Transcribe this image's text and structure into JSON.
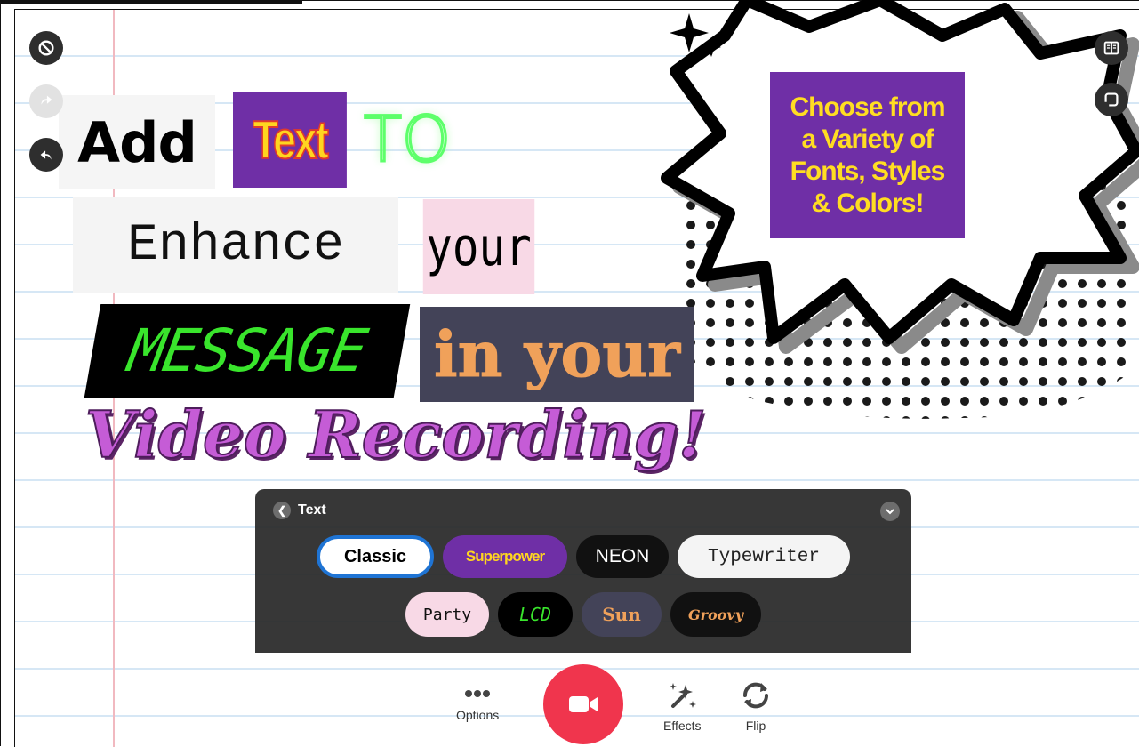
{
  "toolbar_left": {
    "items": [
      {
        "icon": "block-icon",
        "enabled": true
      },
      {
        "icon": "redo-icon",
        "enabled": false
      },
      {
        "icon": "undo-icon",
        "enabled": true
      }
    ]
  },
  "toolbar_right": {
    "items": [
      {
        "icon": "book-icon"
      },
      {
        "icon": "music-note-icon"
      }
    ]
  },
  "canvas_text": {
    "add": "Add",
    "text": "Text",
    "to": "TO",
    "enhance": "Enhance",
    "your": "your",
    "message": "MESSAGE",
    "in_your": "in your",
    "video_recording": "Video Recording!",
    "bubble_lines": [
      "Choose from",
      "a Variety of",
      "Fonts, Styles",
      "& Colors!"
    ]
  },
  "text_panel": {
    "title": "Text",
    "styles_row1": [
      "Classic",
      "Superpower",
      "NEON",
      "Typewriter"
    ],
    "styles_row2": [
      "Party",
      "LCD",
      "Sun",
      "Groovy"
    ],
    "selected": "Classic"
  },
  "bottom_controls": {
    "options_label": "Options",
    "effects_label": "Effects",
    "flip_label": "Flip"
  },
  "colors": {
    "record": "#f0354d",
    "purple": "#6f2fa6",
    "yellow": "#ffd520",
    "selection_border": "#1f74d4"
  }
}
